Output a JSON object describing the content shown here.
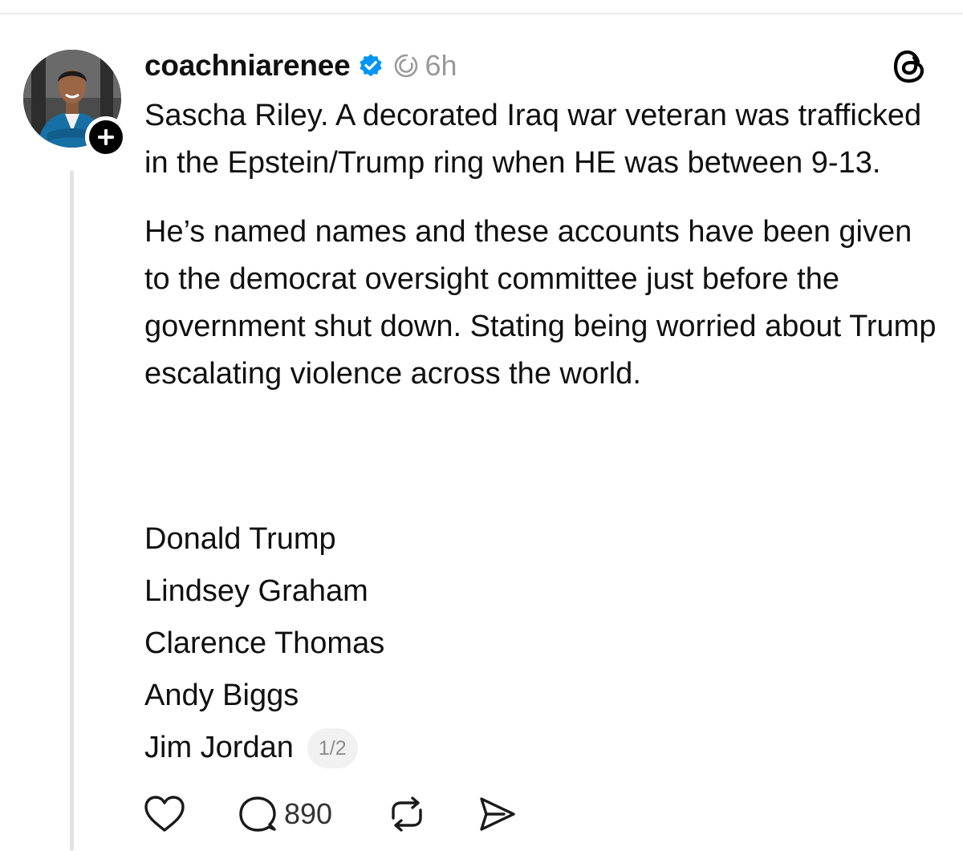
{
  "post": {
    "username": "coachniarenee",
    "time": "6h",
    "paragraphs": [
      "Sascha Riley. A decorated Iraq war veteran was trafficked in the Epstein/Trump ring when HE was between 9-13.",
      "He’s named names and these accounts have been given to the democrat oversight committee just before the government shut down. Stating being worried about Trump escalating violence across the world."
    ],
    "names": [
      "Donald Trump",
      "Lindsey Graham",
      "Clarence Thomas",
      "Andy Biggs",
      "Jim Jordan"
    ],
    "page_indicator": "1/2"
  },
  "actions": {
    "reply_count": "890"
  },
  "icons": {
    "verified": "verified-badge-icon",
    "activity": "activity-ring-icon",
    "threads": "threads-logo-icon",
    "follow": "plus-icon",
    "like": "heart-icon",
    "reply": "comment-icon",
    "repost": "repost-icon",
    "share": "send-icon"
  },
  "colors": {
    "verified": "#0095f6",
    "muted_text": "#999999",
    "text": "#101010",
    "thread_line": "#e3e3e3"
  }
}
